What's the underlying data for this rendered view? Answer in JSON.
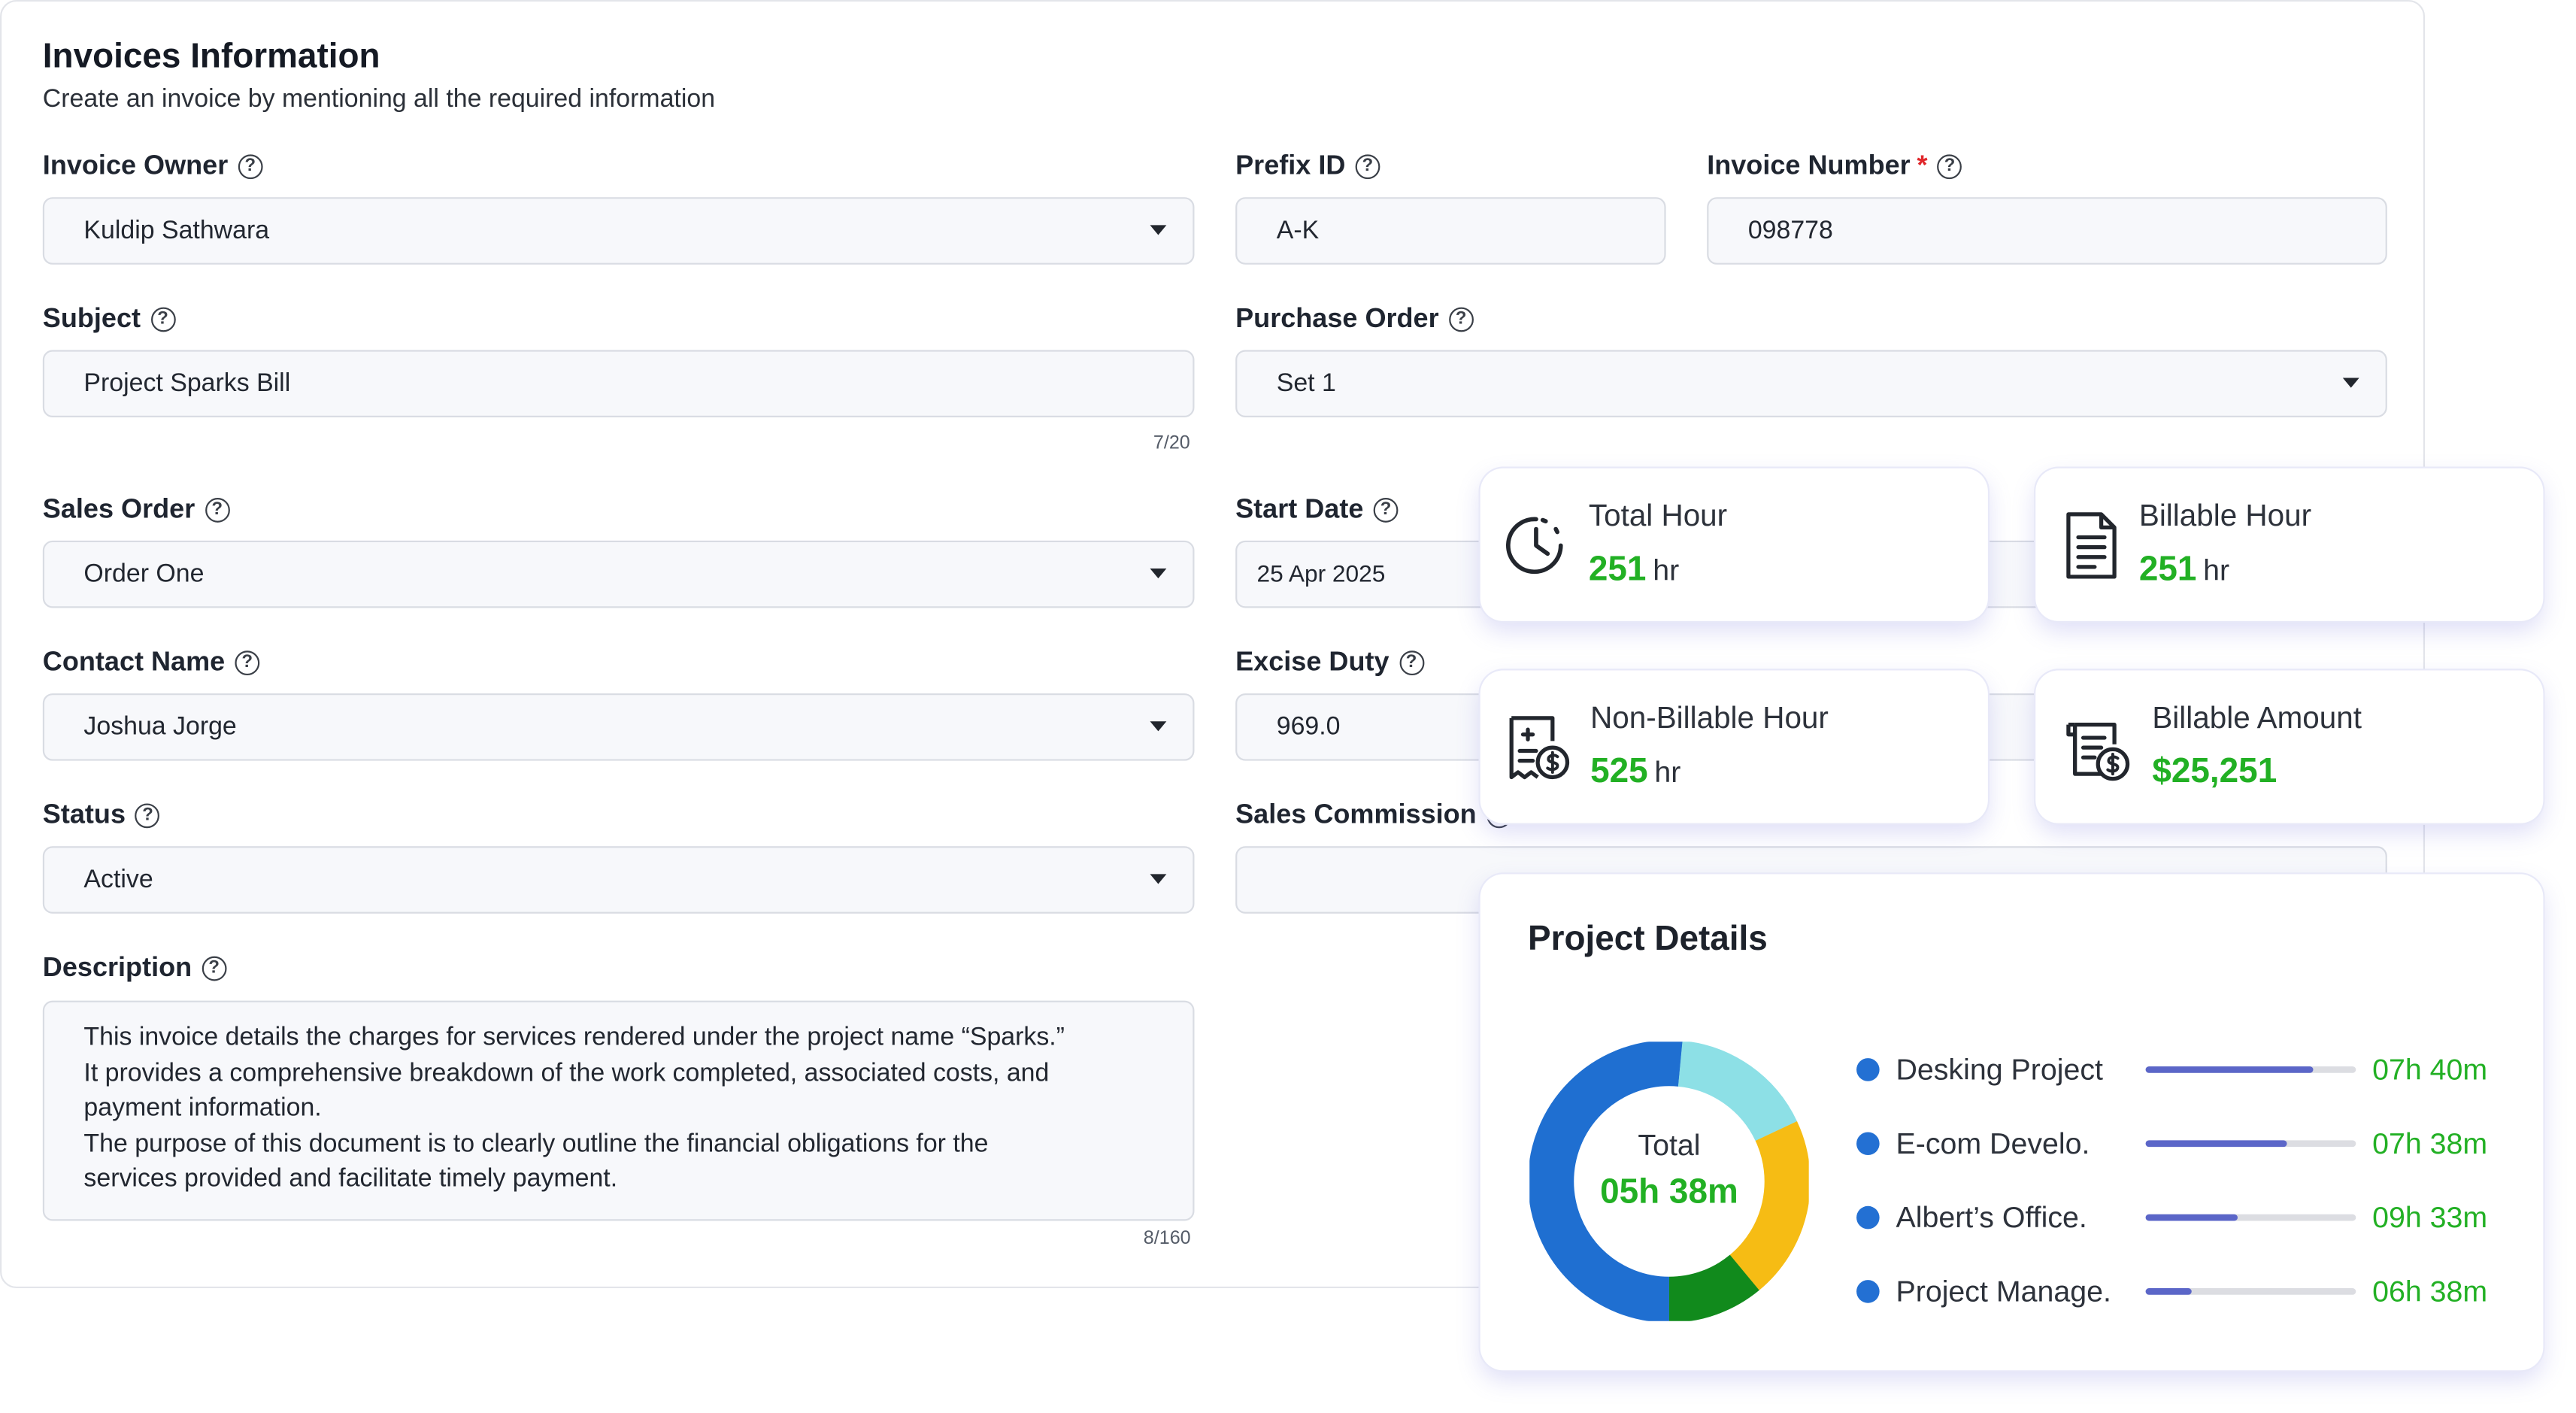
{
  "form": {
    "title": "Invoices Information",
    "subtitle": "Create an invoice by mentioning all the required information",
    "help_glyph": "?",
    "required_mark": "*",
    "invoice_owner": {
      "label": "Invoice Owner",
      "value": "Kuldip Sathwara"
    },
    "prefix_id": {
      "label": "Prefix ID",
      "value": "A-K"
    },
    "invoice_number": {
      "label": "Invoice Number",
      "value": "098778"
    },
    "subject": {
      "label": "Subject",
      "value": "Project Sparks Bill",
      "counter": "7/20"
    },
    "purchase_order": {
      "label": "Purchase Order",
      "value": "Set 1"
    },
    "sales_order": {
      "label": "Sales Order",
      "value": "Order One"
    },
    "start_date": {
      "label": "Start Date",
      "value": "25 Apr 2025"
    },
    "contact_name": {
      "label": "Contact Name",
      "value": "Joshua Jorge"
    },
    "excise_duty": {
      "label": "Excise Duty",
      "value": "969.0"
    },
    "status": {
      "label": "Status",
      "value": "Active"
    },
    "sales_commission": {
      "label": "Sales Commission",
      "value": ""
    },
    "description": {
      "label": "Description",
      "lines": [
        "This invoice details the charges for services rendered under the project name “Sparks.”",
        "It provides a comprehensive breakdown of the work completed, associated costs, and",
        "payment information.",
        "The purpose of this document is to clearly outline the financial obligations for the",
        "services provided and facilitate timely payment."
      ],
      "counter": "8/160"
    }
  },
  "stats": {
    "total_hour": {
      "title": "Total Hour",
      "value": "251",
      "unit": "hr",
      "icon": "clock-icon"
    },
    "billable_hour": {
      "title": "Billable Hour",
      "value": "251",
      "unit": "hr",
      "icon": "document-icon"
    },
    "non_billable_hour": {
      "title": "Non-Billable Hour",
      "value": "525",
      "unit": "hr",
      "icon": "receipt-dollar-icon"
    },
    "billable_amount": {
      "title": "Billable Amount",
      "value": "$25,251",
      "icon": "invoice-dollar-icon"
    }
  },
  "project_details": {
    "title": "Project Details",
    "total_label": "Total",
    "total_value": "05h 38m",
    "donut_segments": [
      {
        "color": "#1f6fd1",
        "fraction": 0.515
      },
      {
        "color": "#8de0e6",
        "fraction": 0.165
      },
      {
        "color": "#f6bc14",
        "fraction": 0.21
      },
      {
        "color": "#118a1c",
        "fraction": 0.11
      }
    ],
    "projects": [
      {
        "name": "Desking Project",
        "time": "07h 40m",
        "progress": 0.8
      },
      {
        "name": "E-com Develo.",
        "time": "07h 38m",
        "progress": 0.67
      },
      {
        "name": "Albert’s Office.",
        "time": "09h 33m",
        "progress": 0.44
      },
      {
        "name": "Project Manage.",
        "time": "06h 38m",
        "progress": 0.22
      }
    ],
    "colors": {
      "accent_green": "#22b024",
      "legend_dot": "#2370d3",
      "bar_fill": "#5b66c8"
    }
  }
}
